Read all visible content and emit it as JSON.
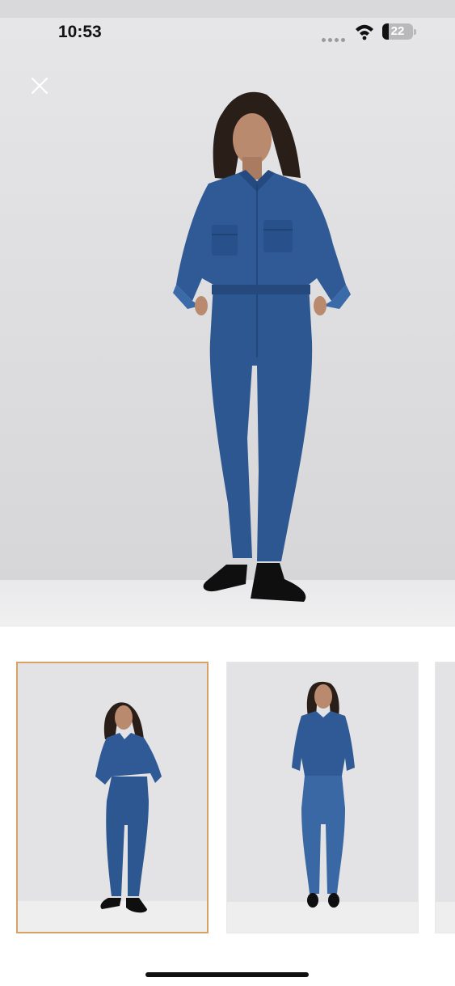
{
  "status_bar": {
    "time": "10:53",
    "battery_level": "22",
    "icons": [
      "signal-dots-icon",
      "wifi-icon",
      "battery-icon"
    ]
  },
  "viewer": {
    "close_icon": "close-icon",
    "main_image": "model-standing-in-denim-shirt-and-skinny-jeans",
    "thumbnails": [
      {
        "image": "model-front-pose-hands-behind",
        "selected": true
      },
      {
        "image": "model-front-pose-arms-down",
        "selected": false
      },
      {
        "image": "partial-third-thumbnail",
        "selected": false
      }
    ]
  },
  "colors": {
    "selected_border": "#d7a264",
    "denim": "#2f5a95",
    "background": "#ffffff"
  }
}
